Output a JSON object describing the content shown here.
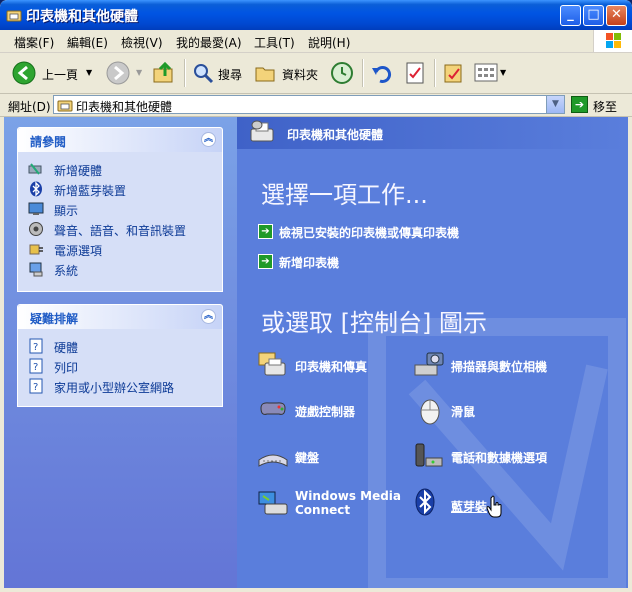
{
  "window": {
    "title": "印表機和其他硬體",
    "controls": [
      "_",
      "□",
      "✕"
    ]
  },
  "menubar": {
    "items": [
      "檔案(F)",
      "編輯(E)",
      "檢視(V)",
      "我的最愛(A)",
      "工具(T)",
      "說明(H)"
    ]
  },
  "toolbar": {
    "back": "上一頁",
    "search": "搜尋",
    "folders": "資料夾"
  },
  "address": {
    "label": "網址(D)",
    "value": "印表機和其他硬體",
    "go": "移至"
  },
  "left": {
    "see_also": {
      "title": "請參閱",
      "items": [
        {
          "label": "新增硬體",
          "icon": "add-hardware-icon"
        },
        {
          "label": "新增藍芽裝置",
          "icon": "bluetooth-icon"
        },
        {
          "label": "顯示",
          "icon": "display-icon"
        },
        {
          "label": "聲音、語音、和音訊裝置",
          "icon": "sound-icon"
        },
        {
          "label": "電源選項",
          "icon": "power-icon"
        },
        {
          "label": "系統",
          "icon": "system-icon"
        }
      ]
    },
    "troubleshoot": {
      "title": "疑難排解",
      "items": [
        {
          "label": "硬體",
          "icon": "help-icon"
        },
        {
          "label": "列印",
          "icon": "help-icon"
        },
        {
          "label": "家用或小型辦公室網路",
          "icon": "help-icon"
        }
      ]
    }
  },
  "main": {
    "header": "印表機和其他硬體",
    "pick_task": "選擇一項工作...",
    "tasks": [
      "檢視已安裝的印表機或傳真印表機",
      "新增印表機"
    ],
    "pick_icon": "或選取 [控制台] 圖示",
    "icons": [
      {
        "label": "印表機和傳真",
        "icon": "printer-fax-icon"
      },
      {
        "label": "掃描器與數位相機",
        "icon": "scanner-camera-icon"
      },
      {
        "label": "遊戲控制器",
        "icon": "game-controller-icon"
      },
      {
        "label": "滑鼠",
        "icon": "mouse-icon"
      },
      {
        "label": "鍵盤",
        "icon": "keyboard-icon"
      },
      {
        "label": "電話和數據機選項",
        "icon": "phone-modem-icon"
      },
      {
        "label": "Windows Media",
        "label2": "Connect",
        "icon": "windows-media-connect-icon"
      },
      {
        "label": "藍芽裝",
        "icon": "bluetooth-icon"
      }
    ]
  },
  "colors": {
    "title_blue": "#0054e3",
    "pane_blue": "#5a7edc",
    "link_blue": "#0c3a96"
  }
}
